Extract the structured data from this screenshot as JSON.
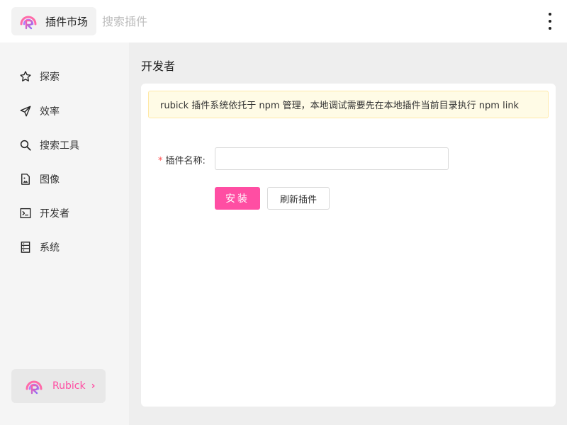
{
  "header": {
    "app_label": "插件市场",
    "search_placeholder": "搜索插件",
    "logo_icon": "rubick-logo-icon",
    "more_icon": "more-vertical-icon"
  },
  "sidebar": {
    "items": [
      {
        "label": "探索",
        "icon": "star-icon"
      },
      {
        "label": "效率",
        "icon": "send-icon"
      },
      {
        "label": "搜索工具",
        "icon": "search-icon"
      },
      {
        "label": "图像",
        "icon": "image-file-icon"
      },
      {
        "label": "开发者",
        "icon": "terminal-icon"
      },
      {
        "label": "系统",
        "icon": "server-icon"
      }
    ],
    "footer": {
      "label": "Rubick",
      "chevron": "›"
    }
  },
  "main": {
    "title": "开发者",
    "notice": "rubick 插件系统依托于 npm 管理，本地调试需要先在本地插件当前目录执行 npm link",
    "form": {
      "required_mark": "*",
      "name_label": "插件名称:",
      "name_value": ""
    },
    "buttons": {
      "install": "安装",
      "refresh": "刷新插件"
    }
  },
  "colors": {
    "accent": "#ff4ea3",
    "sidebar_bg": "#f5f5f5",
    "main_bg": "#eeeeee",
    "notice_bg": "#fffbe6",
    "notice_border": "#ffe9a8"
  }
}
